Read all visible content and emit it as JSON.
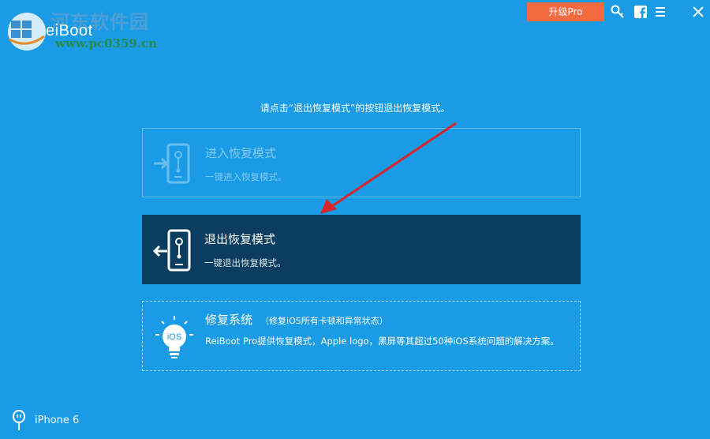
{
  "header": {
    "app_name": "eiBoot",
    "watermark_cn": "河东软件园",
    "watermark_url": "www.pc0359.cn",
    "upgrade_label": "升级Pro"
  },
  "instruction": "请点击“退出恢复模式”的按钮退出恢复模式。",
  "cards": {
    "enter": {
      "title": "进入恢复模式",
      "subtitle": "一键进入恢复模式。"
    },
    "exit": {
      "title": "退出恢复模式",
      "subtitle": "一键退出恢复模式。"
    },
    "repair": {
      "title": "修复系统",
      "note": "（修复iOS所有卡顿和异常状态）",
      "subtitle": "ReiBoot Pro提供恢复模式，Apple logo，黑屏等其超过50种iOS系统问题的解决方案。",
      "icon_text": "iOS"
    }
  },
  "device": {
    "name": "iPhone 6"
  },
  "colors": {
    "background": "#1a9be6",
    "upgrade": "#f36a3f",
    "selected_card": "#0a3d5f",
    "arrow": "#d7262b"
  },
  "icons": [
    "key-icon",
    "facebook-icon",
    "menu-icon",
    "close-icon",
    "phone-enter-icon",
    "phone-exit-icon",
    "lightbulb-ios-icon",
    "usb-cable-icon"
  ]
}
